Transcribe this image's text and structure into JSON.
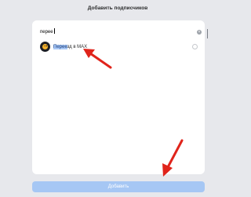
{
  "header": {
    "title": "Добавить подписчиков"
  },
  "search": {
    "value": "перее",
    "clear_icon": "close-icon"
  },
  "list": {
    "items": [
      {
        "label_highlight": "Перее",
        "label_rest": "зд в MAX",
        "selected": false
      }
    ]
  },
  "footer": {
    "add_label": "Добавить"
  },
  "colors": {
    "background": "#e7e8ec",
    "panel": "#ffffff",
    "button": "#a6c7f4",
    "highlight": "#a9c8f5",
    "annotation_arrow": "#e0241b"
  }
}
